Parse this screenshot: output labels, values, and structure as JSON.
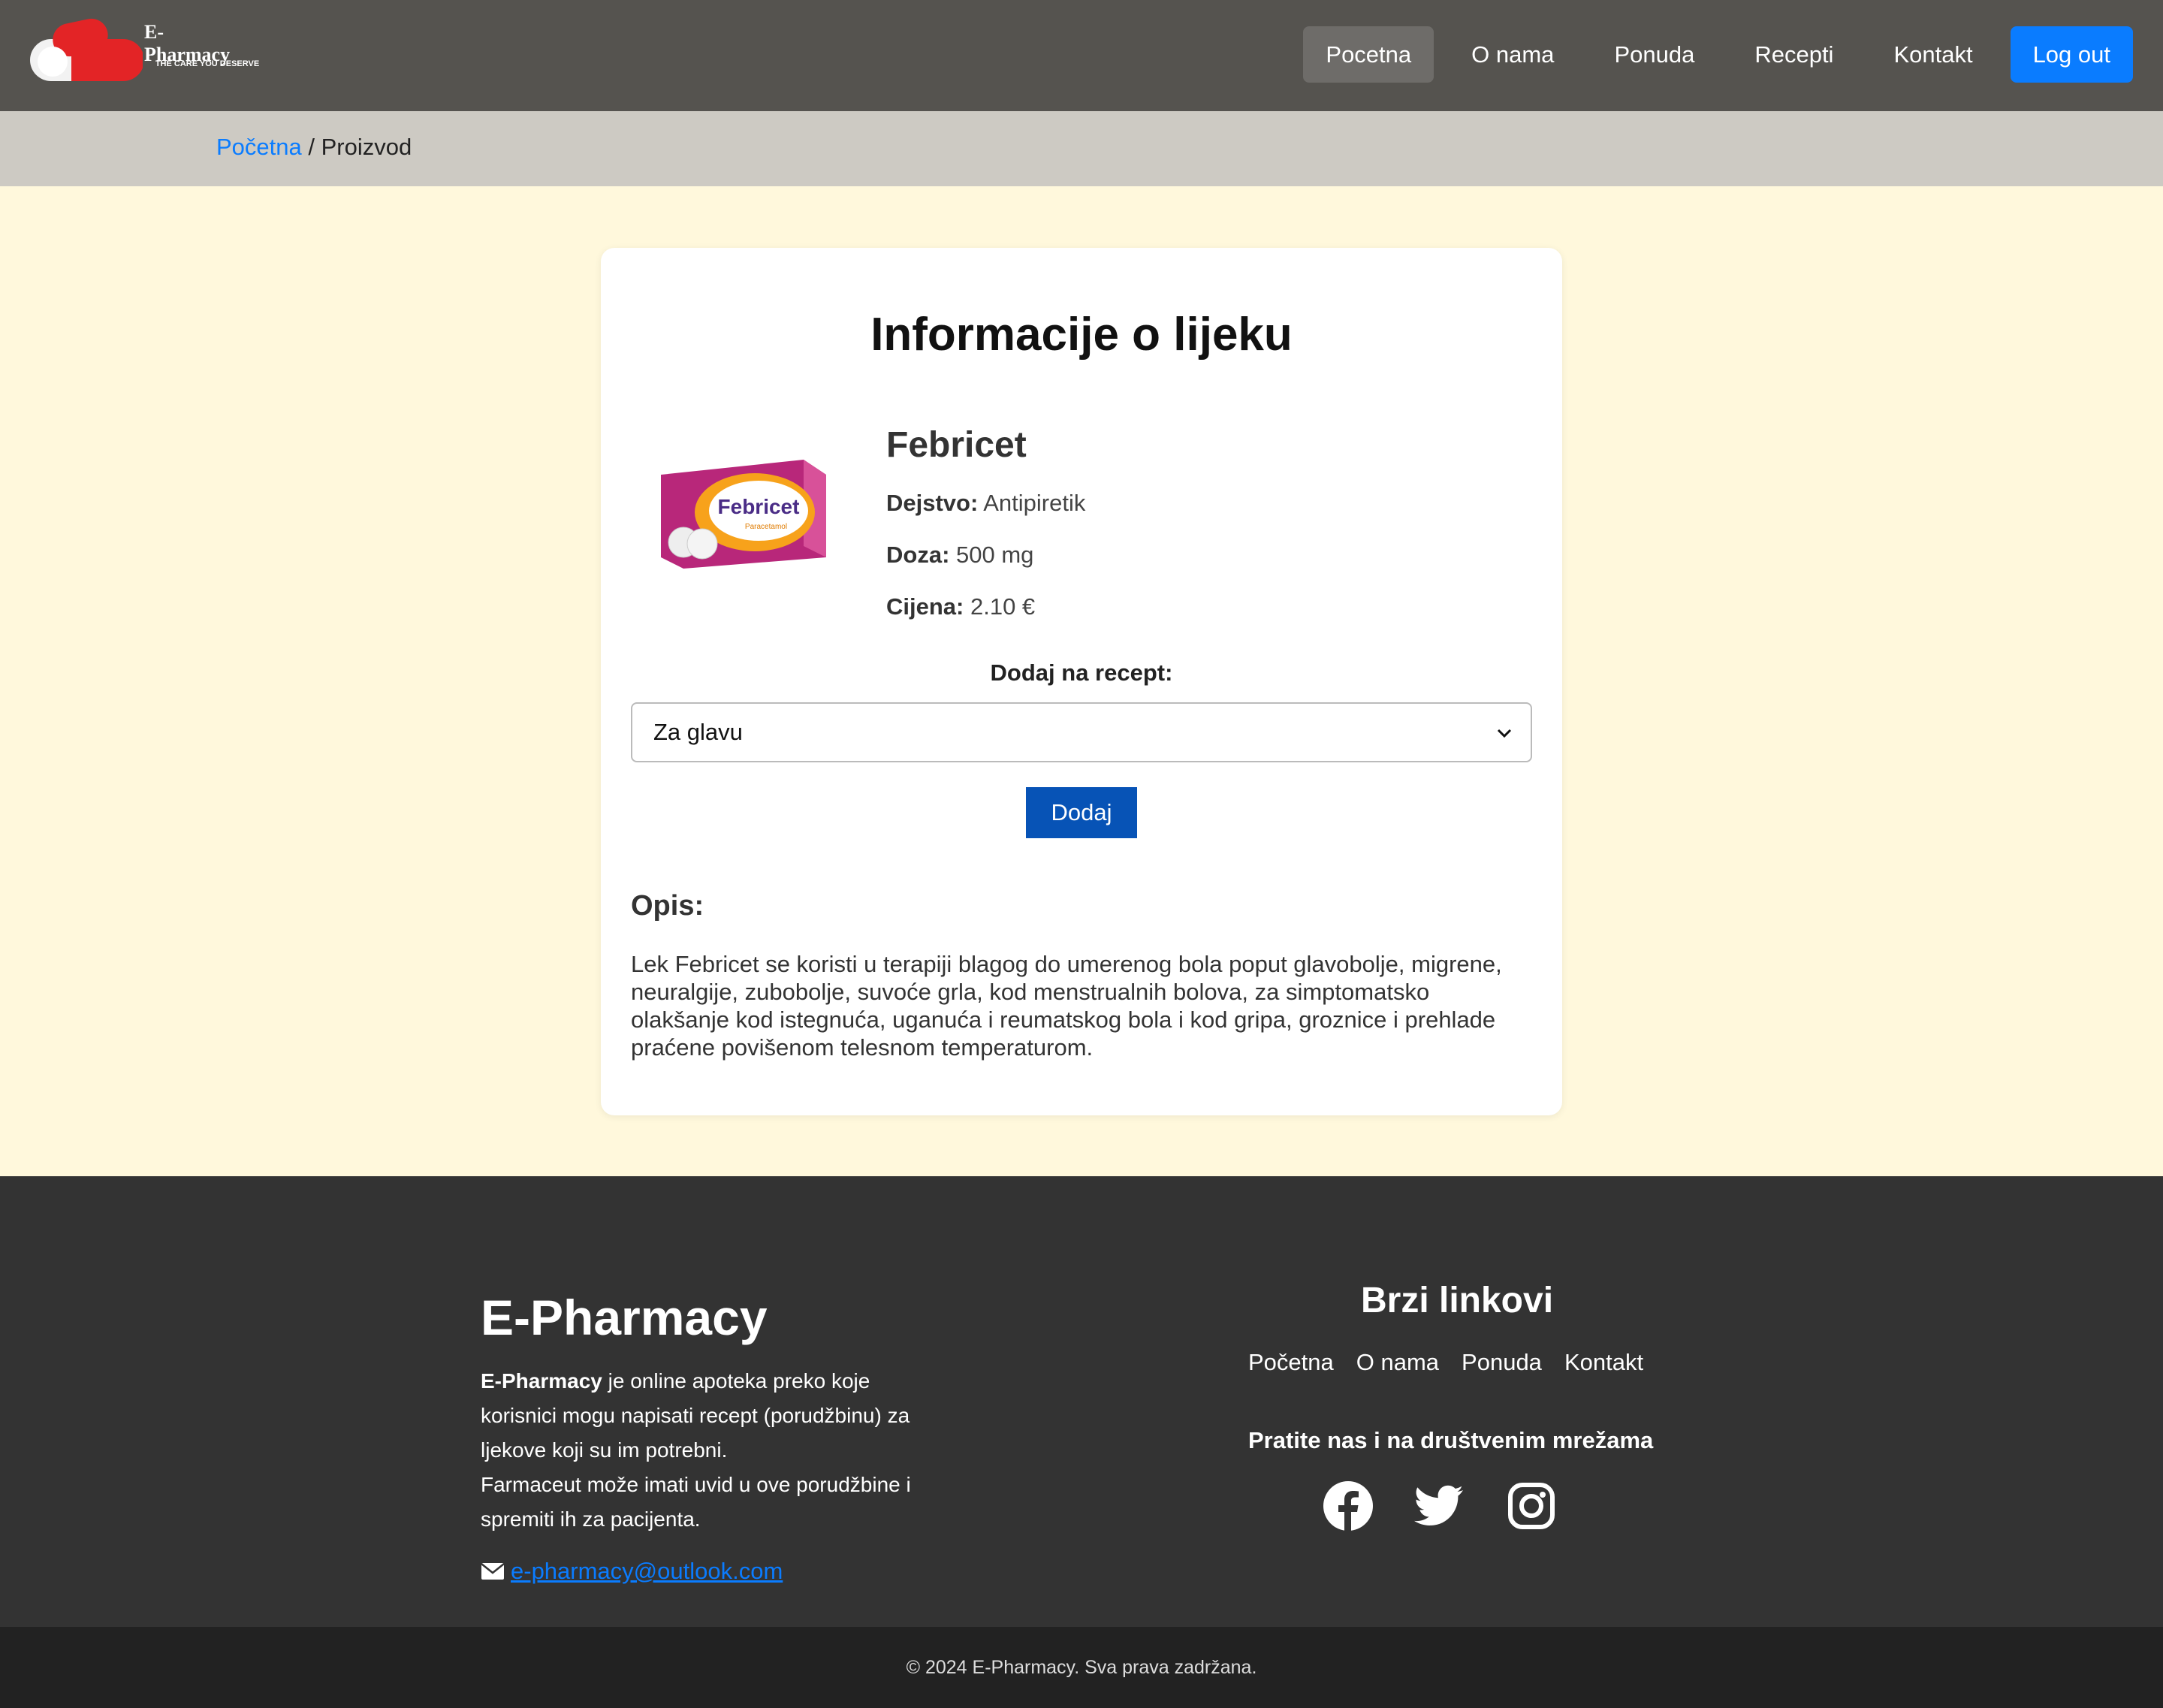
{
  "header": {
    "logo_title": "E-Pharmacy",
    "logo_tagline": "THE CARE YOU DESERVE",
    "nav": [
      {
        "label": "Pocetna",
        "active": true
      },
      {
        "label": "O nama"
      },
      {
        "label": "Ponuda"
      },
      {
        "label": "Recepti"
      },
      {
        "label": "Kontakt"
      }
    ],
    "logout_label": "Log out",
    "colors": {
      "bar": "#55534f",
      "accent": "#0a7cff"
    }
  },
  "breadcrumb": {
    "home": "Početna",
    "separator": " / ",
    "current": "Proizvod"
  },
  "product": {
    "page_title": "Informacije o lijeku",
    "name": "Febricet",
    "box_brand": "Febricet",
    "box_subtext": "Paracetamol",
    "image_icon": "medicine-box-image",
    "fields": [
      {
        "label": "Dejstvo:",
        "value": "Antipiretik"
      },
      {
        "label": "Doza:",
        "value": "500 mg"
      },
      {
        "label": "Cijena:",
        "value": "2.10 €"
      }
    ],
    "add_label": "Dodaj na recept:",
    "select_value": "Za glavu",
    "add_button": "Dodaj",
    "desc_title": "Opis:",
    "desc_text": "Lek Febricet se koristi u terapiji blagog do umerenog bola poput glavobolje, migrene, neuralgije, zubobolje, suvoće grla, kod menstrualnih bolova, za simptomatsko olakšanje kod istegnuća, uganuća i reumatskog bola i kod gripa, groznice i prehlade praćene povišenom telesnom temperaturom."
  },
  "footer": {
    "brand": "E-Pharmacy",
    "desc_bold": "E-Pharmacy",
    "desc_rest": " je online apoteka preko koje korisnici mogu napisati recept (porudžbinu) za ljekove koji su im potrebni.",
    "desc_line2": "Farmaceut može imati uvid u ove porudžbine i spremiti ih za pacijenta.",
    "email": "e-pharmacy@outlook.com",
    "quick_title": "Brzi linkovi",
    "links": [
      "Početna",
      "O nama",
      "Ponuda",
      "Kontakt"
    ],
    "follow": "Pratite nas i na društvenim mrežama",
    "social_icons": [
      "facebook-icon",
      "twitter-icon",
      "instagram-icon"
    ]
  },
  "copyright": "© 2024 E-Pharmacy. Sva prava zadržana."
}
